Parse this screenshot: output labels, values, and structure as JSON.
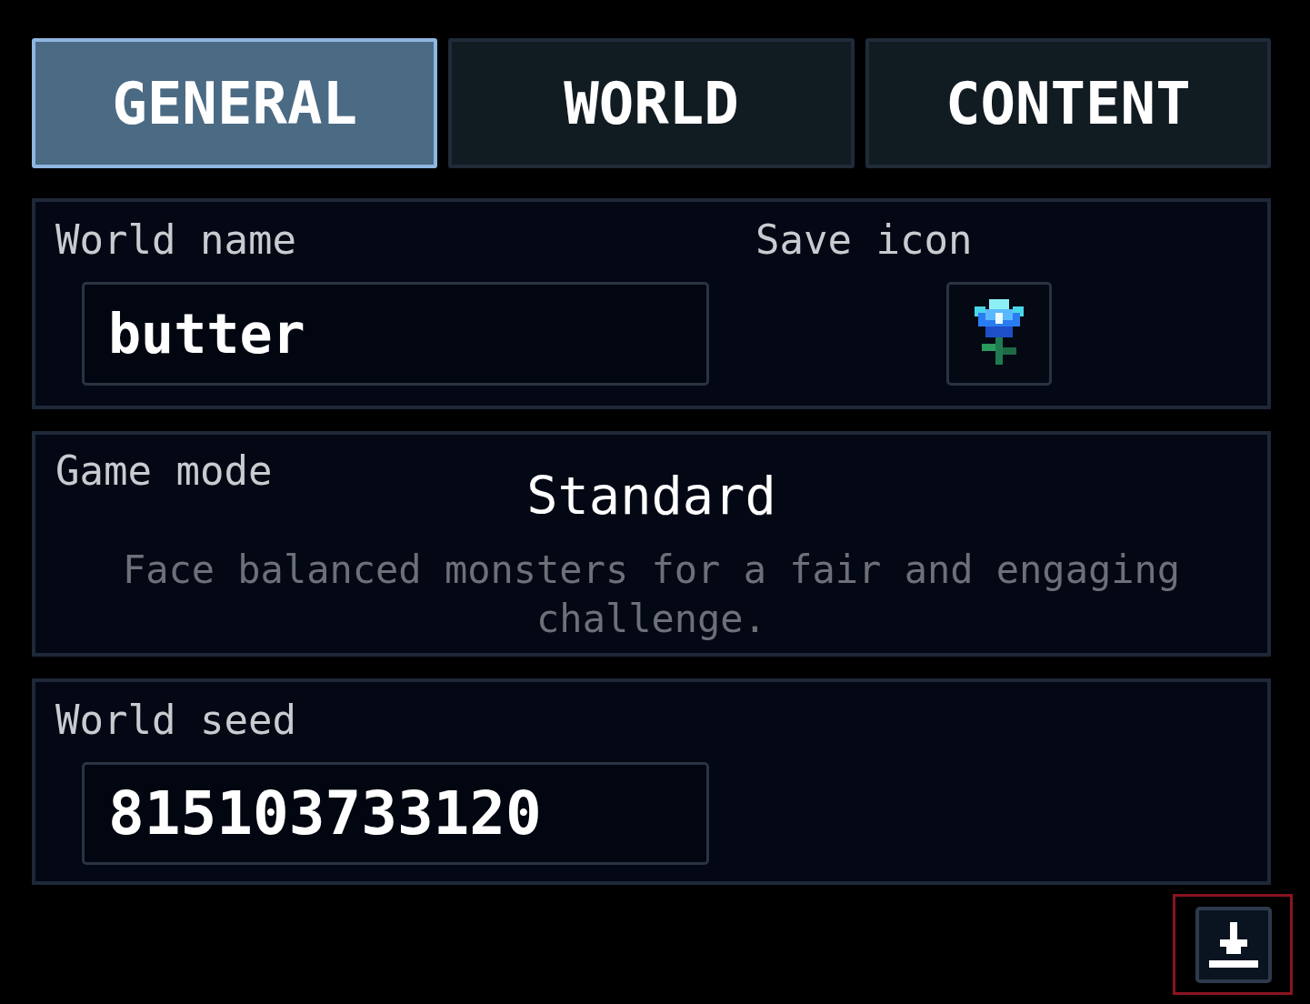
{
  "tabs": [
    {
      "label": "GENERAL",
      "selected": true
    },
    {
      "label": "WORLD",
      "selected": false
    },
    {
      "label": "CONTENT",
      "selected": false
    }
  ],
  "world_name": {
    "label": "World name",
    "value": "butter"
  },
  "save_icon": {
    "label": "Save icon"
  },
  "game_mode": {
    "label": "Game mode",
    "value": "Standard",
    "description": "Face balanced monsters for a fair and engaging challenge."
  },
  "world_seed": {
    "label": "World seed",
    "value": "815103733120"
  },
  "download_button": {
    "focused": true
  }
}
